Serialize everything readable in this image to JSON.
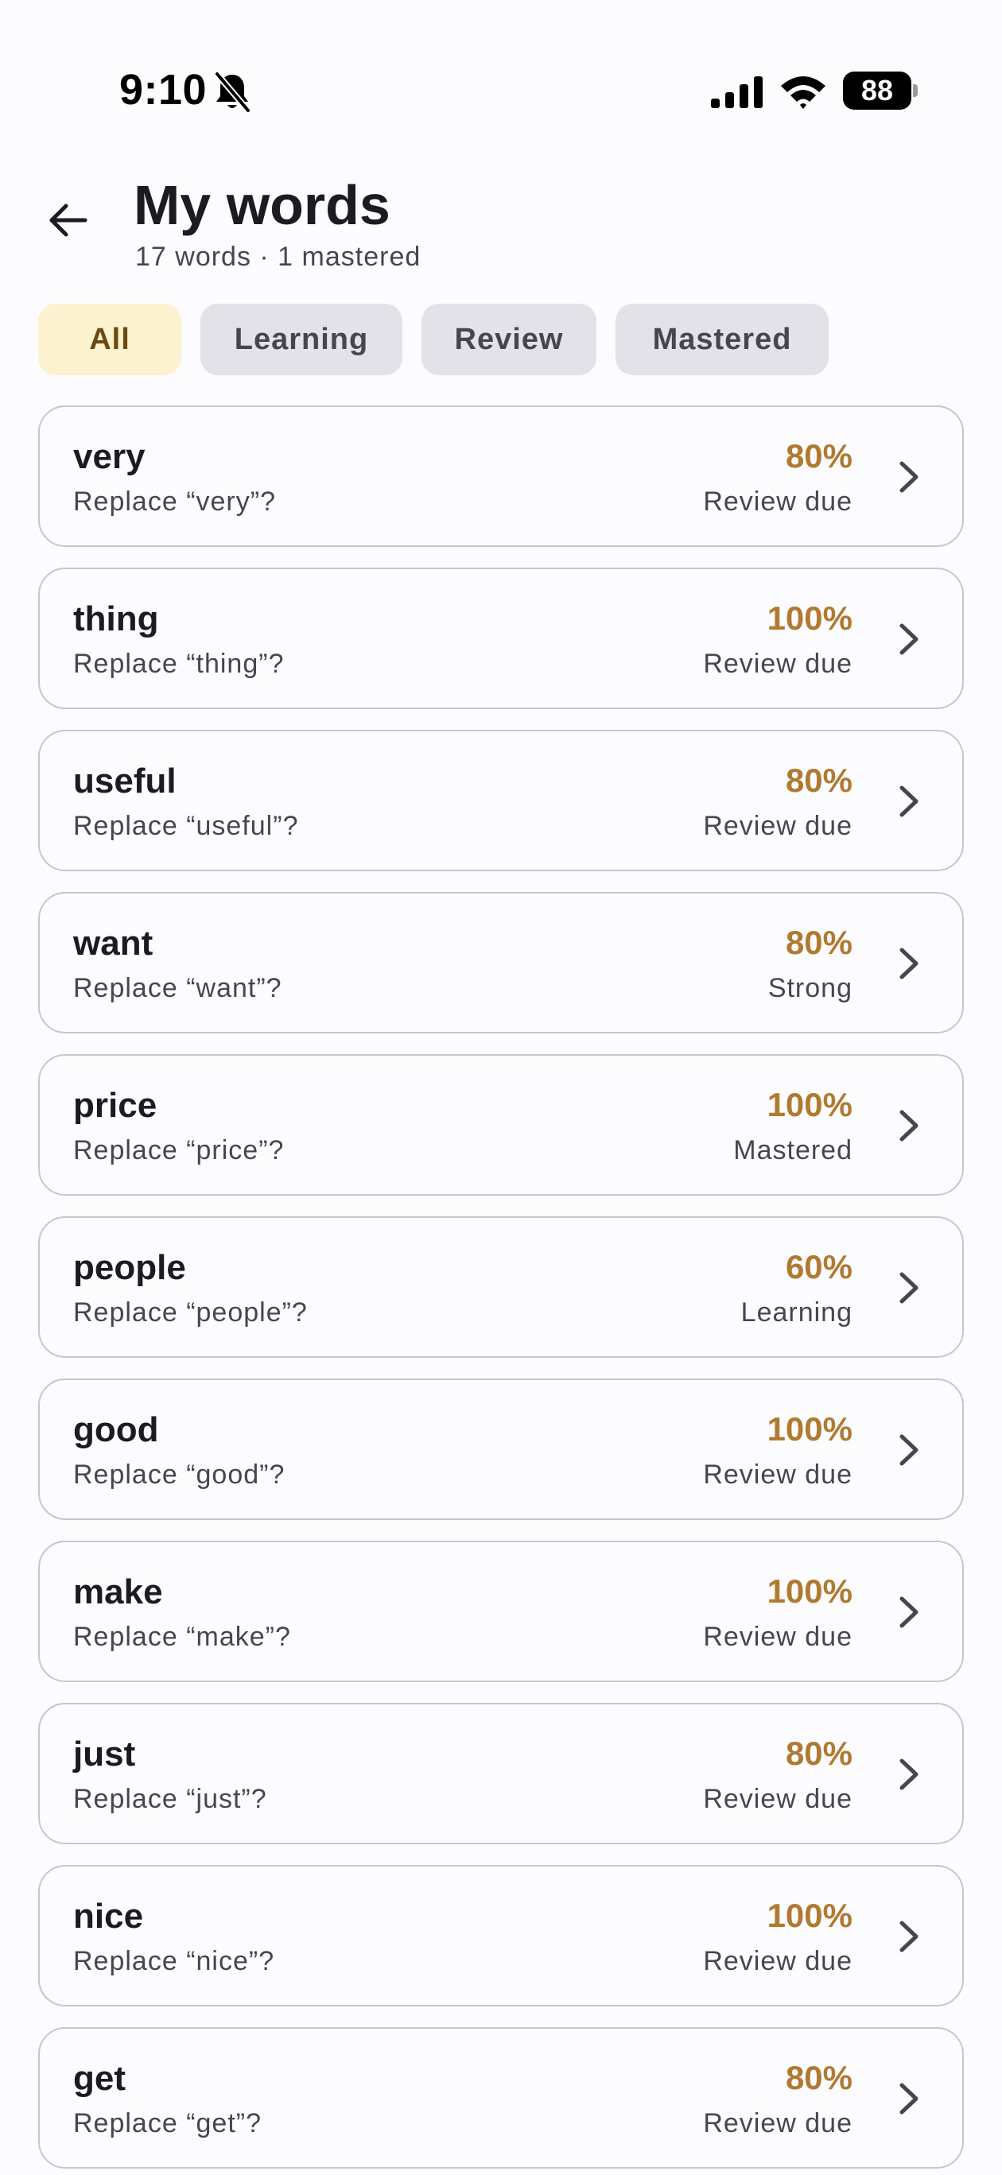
{
  "status_bar": {
    "time": "9:10",
    "battery": "88",
    "icons": [
      "bell-off-icon",
      "signal-icon",
      "wifi-icon",
      "battery-icon"
    ]
  },
  "header": {
    "back_icon": "arrow-left-icon",
    "title": "My words",
    "subtitle": "17 words · 1 mastered"
  },
  "filters": [
    {
      "label": "All",
      "selected": true
    },
    {
      "label": "Learning",
      "selected": false
    },
    {
      "label": "Review",
      "selected": false
    },
    {
      "label": "Mastered",
      "selected": false
    }
  ],
  "colors": {
    "accent": "#b07a30",
    "chip_selected_bg": "#fdf2cf",
    "chip_bg": "#e3e2e9"
  },
  "words": [
    {
      "term": "very",
      "prompt": "Replace “very”?",
      "percent": "80%",
      "status": "Review due"
    },
    {
      "term": "thing",
      "prompt": "Replace “thing”?",
      "percent": "100%",
      "status": "Review due"
    },
    {
      "term": "useful",
      "prompt": "Replace “useful”?",
      "percent": "80%",
      "status": "Review due"
    },
    {
      "term": "want",
      "prompt": "Replace “want”?",
      "percent": "80%",
      "status": "Strong"
    },
    {
      "term": "price",
      "prompt": "Replace “price”?",
      "percent": "100%",
      "status": "Mastered"
    },
    {
      "term": "people",
      "prompt": "Replace “people”?",
      "percent": "60%",
      "status": "Learning"
    },
    {
      "term": "good",
      "prompt": "Replace “good”?",
      "percent": "100%",
      "status": "Review due"
    },
    {
      "term": "make",
      "prompt": "Replace “make”?",
      "percent": "100%",
      "status": "Review due"
    },
    {
      "term": "just",
      "prompt": "Replace “just”?",
      "percent": "80%",
      "status": "Review due"
    },
    {
      "term": "nice",
      "prompt": "Replace “nice”?",
      "percent": "100%",
      "status": "Review due"
    },
    {
      "term": "get",
      "prompt": "Replace “get”?",
      "percent": "80%",
      "status": "Review due"
    }
  ]
}
